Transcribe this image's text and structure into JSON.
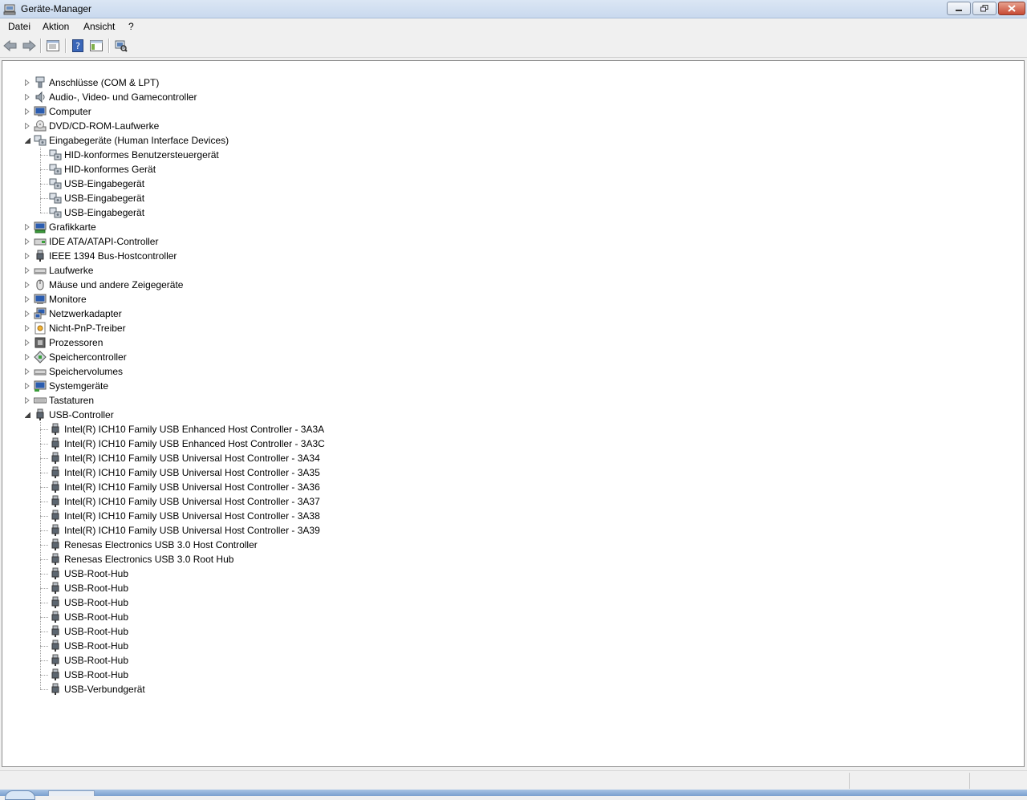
{
  "window": {
    "title": "Geräte-Manager"
  },
  "menu": [
    "Datei",
    "Aktion",
    "Ansicht",
    "?"
  ],
  "toolbar": [
    {
      "icon": "back-arrow-icon"
    },
    {
      "icon": "forward-arrow-icon"
    },
    {
      "icon": "properties-view-icon"
    },
    {
      "icon": "help-icon"
    },
    {
      "icon": "console-tree-icon"
    },
    {
      "icon": "scan-hardware-icon"
    }
  ],
  "tree": [
    {
      "label": "Anschlüsse (COM & LPT)",
      "level": 0,
      "expander": "collapsed",
      "icon": "port-icon"
    },
    {
      "label": "Audio-, Video- und Gamecontroller",
      "level": 0,
      "expander": "collapsed",
      "icon": "speaker-icon"
    },
    {
      "label": "Computer",
      "level": 0,
      "expander": "collapsed",
      "icon": "computer-icon"
    },
    {
      "label": "DVD/CD-ROM-Laufwerke",
      "level": 0,
      "expander": "collapsed",
      "icon": "dvd-drive-icon"
    },
    {
      "label": "Eingabegeräte (Human Interface Devices)",
      "level": 0,
      "expander": "expanded",
      "icon": "hid-icon"
    },
    {
      "label": "HID-konformes Benutzersteuergerät",
      "level": 1,
      "icon": "hid-icon"
    },
    {
      "label": "HID-konformes Gerät",
      "level": 1,
      "icon": "hid-icon"
    },
    {
      "label": "USB-Eingabegerät",
      "level": 1,
      "icon": "hid-icon"
    },
    {
      "label": "USB-Eingabegerät",
      "level": 1,
      "icon": "hid-icon"
    },
    {
      "label": "USB-Eingabegerät",
      "level": 1,
      "icon": "hid-icon"
    },
    {
      "label": "Grafikkarte",
      "level": 0,
      "expander": "collapsed",
      "icon": "display-adapter-icon"
    },
    {
      "label": "IDE ATA/ATAPI-Controller",
      "level": 0,
      "expander": "collapsed",
      "icon": "ide-controller-icon"
    },
    {
      "label": "IEEE 1394 Bus-Hostcontroller",
      "level": 0,
      "expander": "collapsed",
      "icon": "usb-plug-icon"
    },
    {
      "label": "Laufwerke",
      "level": 0,
      "expander": "collapsed",
      "icon": "disk-drive-icon"
    },
    {
      "label": "Mäuse und andere Zeigegeräte",
      "level": 0,
      "expander": "collapsed",
      "icon": "mouse-icon"
    },
    {
      "label": "Monitore",
      "level": 0,
      "expander": "collapsed",
      "icon": "monitor-icon"
    },
    {
      "label": "Netzwerkadapter",
      "level": 0,
      "expander": "collapsed",
      "icon": "network-adapter-icon"
    },
    {
      "label": "Nicht-PnP-Treiber",
      "level": 0,
      "expander": "collapsed",
      "icon": "non-pnp-driver-icon"
    },
    {
      "label": "Prozessoren",
      "level": 0,
      "expander": "collapsed",
      "icon": "processor-icon"
    },
    {
      "label": "Speichercontroller",
      "level": 0,
      "expander": "collapsed",
      "icon": "storage-controller-icon"
    },
    {
      "label": "Speichervolumes",
      "level": 0,
      "expander": "collapsed",
      "icon": "disk-drive-icon"
    },
    {
      "label": "Systemgeräte",
      "level": 0,
      "expander": "collapsed",
      "icon": "system-device-icon"
    },
    {
      "label": "Tastaturen",
      "level": 0,
      "expander": "collapsed",
      "icon": "keyboard-icon"
    },
    {
      "label": "USB-Controller",
      "level": 0,
      "expander": "expanded",
      "icon": "usb-plug-icon"
    },
    {
      "label": "Intel(R) ICH10 Family USB Enhanced Host Controller - 3A3A",
      "level": 1,
      "icon": "usb-plug-icon"
    },
    {
      "label": "Intel(R) ICH10 Family USB Enhanced Host Controller - 3A3C",
      "level": 1,
      "icon": "usb-plug-icon"
    },
    {
      "label": "Intel(R) ICH10 Family USB Universal Host Controller - 3A34",
      "level": 1,
      "icon": "usb-plug-icon"
    },
    {
      "label": "Intel(R) ICH10 Family USB Universal Host Controller - 3A35",
      "level": 1,
      "icon": "usb-plug-icon"
    },
    {
      "label": "Intel(R) ICH10 Family USB Universal Host Controller - 3A36",
      "level": 1,
      "icon": "usb-plug-icon"
    },
    {
      "label": "Intel(R) ICH10 Family USB Universal Host Controller - 3A37",
      "level": 1,
      "icon": "usb-plug-icon"
    },
    {
      "label": "Intel(R) ICH10 Family USB Universal Host Controller - 3A38",
      "level": 1,
      "icon": "usb-plug-icon"
    },
    {
      "label": "Intel(R) ICH10 Family USB Universal Host Controller - 3A39",
      "level": 1,
      "icon": "usb-plug-icon"
    },
    {
      "label": "Renesas Electronics USB 3.0 Host Controller",
      "level": 1,
      "icon": "usb-plug-icon"
    },
    {
      "label": "Renesas Electronics USB 3.0 Root Hub",
      "level": 1,
      "icon": "usb-plug-icon"
    },
    {
      "label": "USB-Root-Hub",
      "level": 1,
      "icon": "usb-plug-icon"
    },
    {
      "label": "USB-Root-Hub",
      "level": 1,
      "icon": "usb-plug-icon"
    },
    {
      "label": "USB-Root-Hub",
      "level": 1,
      "icon": "usb-plug-icon"
    },
    {
      "label": "USB-Root-Hub",
      "level": 1,
      "icon": "usb-plug-icon"
    },
    {
      "label": "USB-Root-Hub",
      "level": 1,
      "icon": "usb-plug-icon"
    },
    {
      "label": "USB-Root-Hub",
      "level": 1,
      "icon": "usb-plug-icon"
    },
    {
      "label": "USB-Root-Hub",
      "level": 1,
      "icon": "usb-plug-icon"
    },
    {
      "label": "USB-Root-Hub",
      "level": 1,
      "icon": "usb-plug-icon"
    },
    {
      "label": "USB-Verbundgerät",
      "level": 1,
      "icon": "usb-plug-icon"
    }
  ]
}
